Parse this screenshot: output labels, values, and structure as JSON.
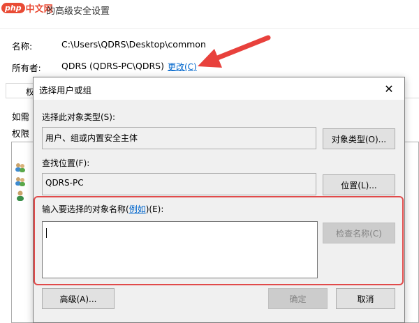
{
  "background": {
    "logo_php": "php",
    "logo_cn": "中文网",
    "title_partial": "的高级安全设置",
    "name_label": "名称:",
    "name_value": "C:\\Users\\QDRS\\Desktop\\common",
    "owner_label": "所有者:",
    "owner_value": "QDRS (QDRS-PC\\QDRS)",
    "change_link": "更改(C)",
    "tab_fragment": "权",
    "frag_1": "如需",
    "frag_2": "权限",
    "icons": [
      "group-icon",
      "group-icon",
      "user-icon"
    ]
  },
  "dialog": {
    "title": "选择用户或组",
    "close_symbol": "✕",
    "object_type_label": "选择此对象类型(S):",
    "object_type_value": "用户、组或内置安全主体",
    "object_type_button": "对象类型(O)...",
    "location_label": "查找位置(F):",
    "location_value": "QDRS-PC",
    "location_button": "位置(L)...",
    "names_label_pre": "输入要选择的对象名称(",
    "names_label_link": "例如",
    "names_label_post": ")(E):",
    "names_value": "",
    "check_names_button": "检查名称(C)",
    "advanced_button": "高级(A)...",
    "ok_button": "确定",
    "cancel_button": "取消"
  },
  "colors": {
    "highlight": "#e14a4a",
    "arrow": "#e8413c",
    "link": "#0066cc"
  }
}
